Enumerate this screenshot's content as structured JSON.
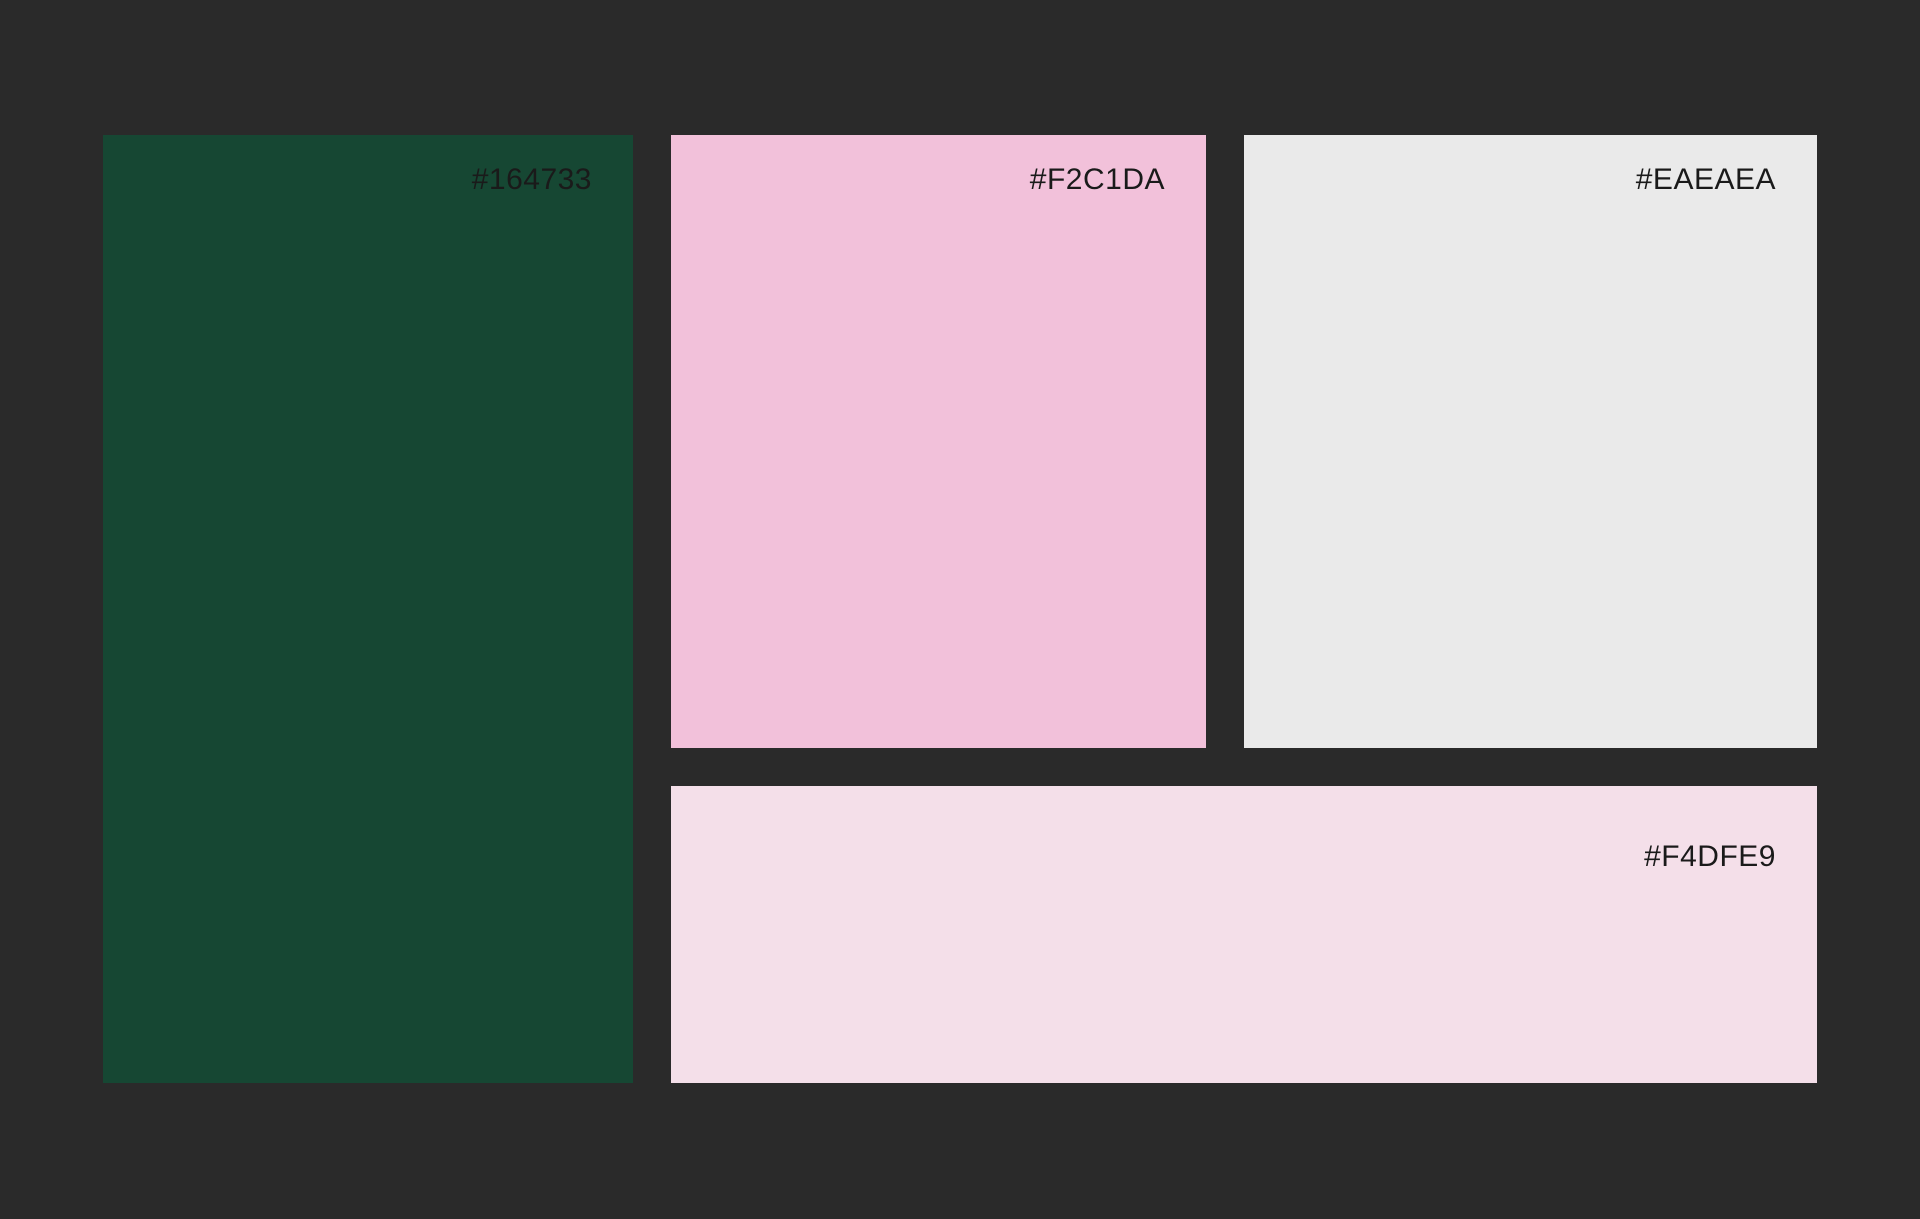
{
  "swatches": [
    {
      "id": "green",
      "label": "#164733",
      "color": "#164733"
    },
    {
      "id": "pink",
      "label": "#F2C1DA",
      "color": "#F2C1DA"
    },
    {
      "id": "grey",
      "label": "#EAEAEA",
      "color": "#EAEAEA"
    },
    {
      "id": "light",
      "label": "#F4DFE9",
      "color": "#F4DFE9"
    }
  ],
  "background_color": "#2A2A2A"
}
